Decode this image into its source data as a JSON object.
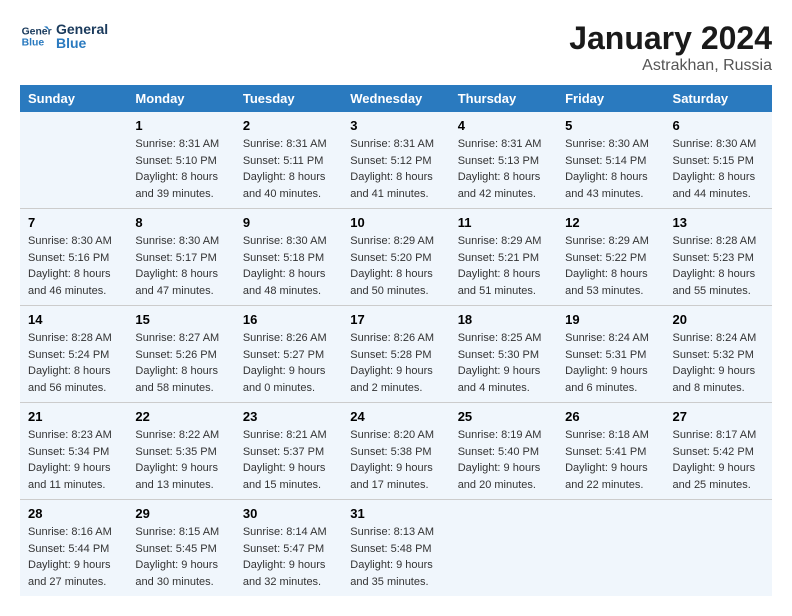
{
  "header": {
    "logo_line1": "General",
    "logo_line2": "Blue",
    "main_title": "January 2024",
    "subtitle": "Astrakhan, Russia"
  },
  "days_of_week": [
    "Sunday",
    "Monday",
    "Tuesday",
    "Wednesday",
    "Thursday",
    "Friday",
    "Saturday"
  ],
  "weeks": [
    [
      {
        "day": "",
        "info": ""
      },
      {
        "day": "1",
        "info": "Sunrise: 8:31 AM\nSunset: 5:10 PM\nDaylight: 8 hours\nand 39 minutes."
      },
      {
        "day": "2",
        "info": "Sunrise: 8:31 AM\nSunset: 5:11 PM\nDaylight: 8 hours\nand 40 minutes."
      },
      {
        "day": "3",
        "info": "Sunrise: 8:31 AM\nSunset: 5:12 PM\nDaylight: 8 hours\nand 41 minutes."
      },
      {
        "day": "4",
        "info": "Sunrise: 8:31 AM\nSunset: 5:13 PM\nDaylight: 8 hours\nand 42 minutes."
      },
      {
        "day": "5",
        "info": "Sunrise: 8:30 AM\nSunset: 5:14 PM\nDaylight: 8 hours\nand 43 minutes."
      },
      {
        "day": "6",
        "info": "Sunrise: 8:30 AM\nSunset: 5:15 PM\nDaylight: 8 hours\nand 44 minutes."
      }
    ],
    [
      {
        "day": "7",
        "info": "Sunrise: 8:30 AM\nSunset: 5:16 PM\nDaylight: 8 hours\nand 46 minutes."
      },
      {
        "day": "8",
        "info": "Sunrise: 8:30 AM\nSunset: 5:17 PM\nDaylight: 8 hours\nand 47 minutes."
      },
      {
        "day": "9",
        "info": "Sunrise: 8:30 AM\nSunset: 5:18 PM\nDaylight: 8 hours\nand 48 minutes."
      },
      {
        "day": "10",
        "info": "Sunrise: 8:29 AM\nSunset: 5:20 PM\nDaylight: 8 hours\nand 50 minutes."
      },
      {
        "day": "11",
        "info": "Sunrise: 8:29 AM\nSunset: 5:21 PM\nDaylight: 8 hours\nand 51 minutes."
      },
      {
        "day": "12",
        "info": "Sunrise: 8:29 AM\nSunset: 5:22 PM\nDaylight: 8 hours\nand 53 minutes."
      },
      {
        "day": "13",
        "info": "Sunrise: 8:28 AM\nSunset: 5:23 PM\nDaylight: 8 hours\nand 55 minutes."
      }
    ],
    [
      {
        "day": "14",
        "info": "Sunrise: 8:28 AM\nSunset: 5:24 PM\nDaylight: 8 hours\nand 56 minutes."
      },
      {
        "day": "15",
        "info": "Sunrise: 8:27 AM\nSunset: 5:26 PM\nDaylight: 8 hours\nand 58 minutes."
      },
      {
        "day": "16",
        "info": "Sunrise: 8:26 AM\nSunset: 5:27 PM\nDaylight: 9 hours\nand 0 minutes."
      },
      {
        "day": "17",
        "info": "Sunrise: 8:26 AM\nSunset: 5:28 PM\nDaylight: 9 hours\nand 2 minutes."
      },
      {
        "day": "18",
        "info": "Sunrise: 8:25 AM\nSunset: 5:30 PM\nDaylight: 9 hours\nand 4 minutes."
      },
      {
        "day": "19",
        "info": "Sunrise: 8:24 AM\nSunset: 5:31 PM\nDaylight: 9 hours\nand 6 minutes."
      },
      {
        "day": "20",
        "info": "Sunrise: 8:24 AM\nSunset: 5:32 PM\nDaylight: 9 hours\nand 8 minutes."
      }
    ],
    [
      {
        "day": "21",
        "info": "Sunrise: 8:23 AM\nSunset: 5:34 PM\nDaylight: 9 hours\nand 11 minutes."
      },
      {
        "day": "22",
        "info": "Sunrise: 8:22 AM\nSunset: 5:35 PM\nDaylight: 9 hours\nand 13 minutes."
      },
      {
        "day": "23",
        "info": "Sunrise: 8:21 AM\nSunset: 5:37 PM\nDaylight: 9 hours\nand 15 minutes."
      },
      {
        "day": "24",
        "info": "Sunrise: 8:20 AM\nSunset: 5:38 PM\nDaylight: 9 hours\nand 17 minutes."
      },
      {
        "day": "25",
        "info": "Sunrise: 8:19 AM\nSunset: 5:40 PM\nDaylight: 9 hours\nand 20 minutes."
      },
      {
        "day": "26",
        "info": "Sunrise: 8:18 AM\nSunset: 5:41 PM\nDaylight: 9 hours\nand 22 minutes."
      },
      {
        "day": "27",
        "info": "Sunrise: 8:17 AM\nSunset: 5:42 PM\nDaylight: 9 hours\nand 25 minutes."
      }
    ],
    [
      {
        "day": "28",
        "info": "Sunrise: 8:16 AM\nSunset: 5:44 PM\nDaylight: 9 hours\nand 27 minutes."
      },
      {
        "day": "29",
        "info": "Sunrise: 8:15 AM\nSunset: 5:45 PM\nDaylight: 9 hours\nand 30 minutes."
      },
      {
        "day": "30",
        "info": "Sunrise: 8:14 AM\nSunset: 5:47 PM\nDaylight: 9 hours\nand 32 minutes."
      },
      {
        "day": "31",
        "info": "Sunrise: 8:13 AM\nSunset: 5:48 PM\nDaylight: 9 hours\nand 35 minutes."
      },
      {
        "day": "",
        "info": ""
      },
      {
        "day": "",
        "info": ""
      },
      {
        "day": "",
        "info": ""
      }
    ]
  ]
}
